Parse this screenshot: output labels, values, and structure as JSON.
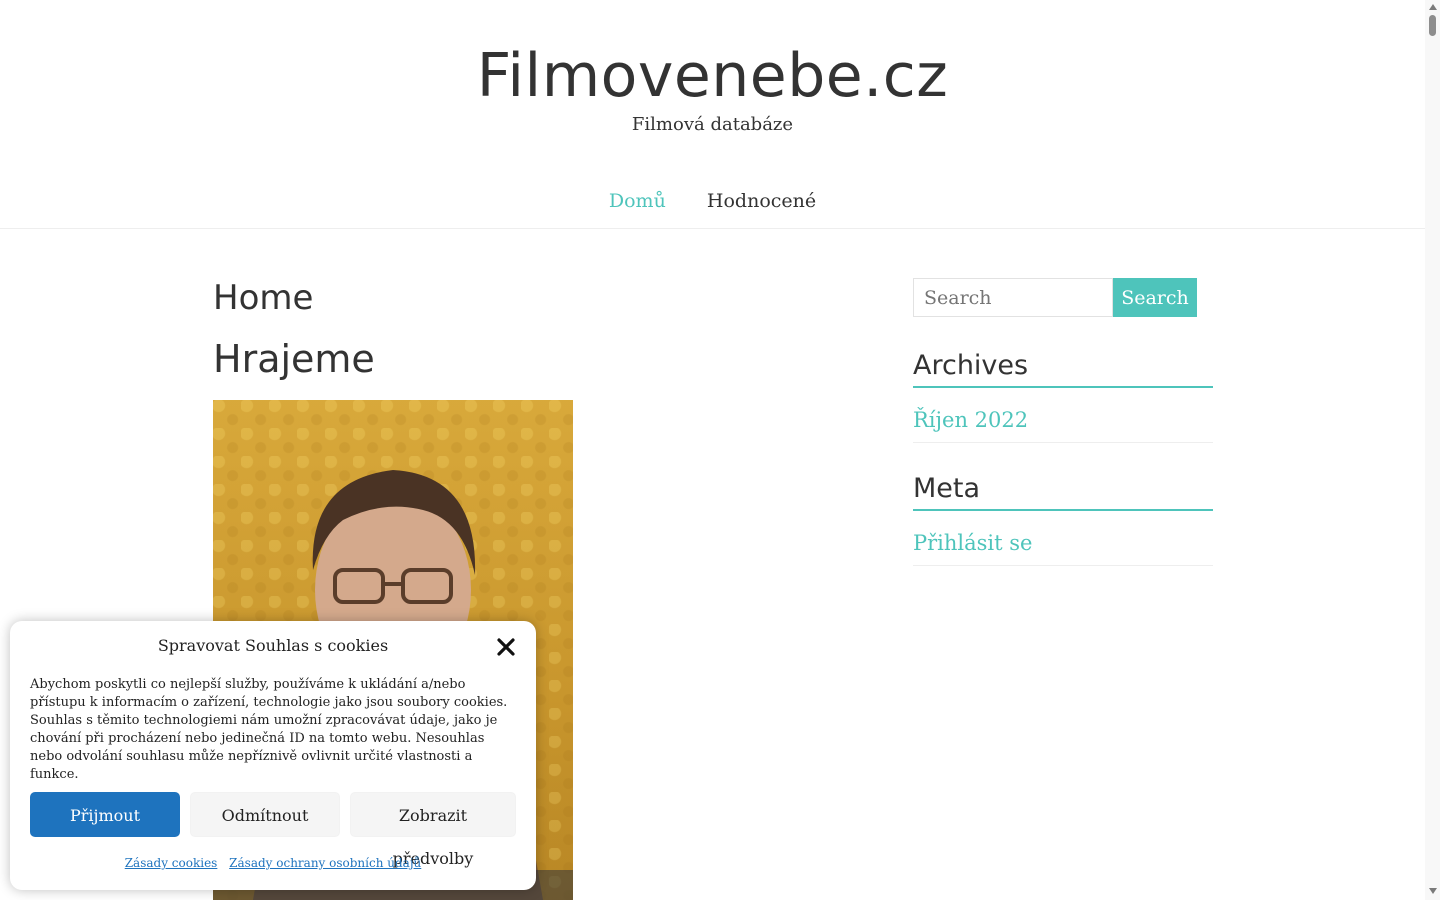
{
  "header": {
    "site_title": "Filmovenebe.cz",
    "tagline": "Filmová databáze",
    "nav": [
      {
        "label": "Domů",
        "active": true
      },
      {
        "label": "Hodnocené",
        "active": false
      }
    ]
  },
  "main": {
    "page_title": "Home",
    "post_title": "Hrajeme"
  },
  "sidebar": {
    "search": {
      "placeholder": "Search",
      "button_label": "Search"
    },
    "archives": {
      "title": "Archives",
      "items": [
        "Říjen 2022"
      ]
    },
    "meta": {
      "title": "Meta",
      "items": [
        "Přihlásit se"
      ]
    }
  },
  "cookie_banner": {
    "title": "Spravovat Souhlas s cookies",
    "text": "Abychom poskytli co nejlepší služby, používáme k ukládání a/nebo přístupu k informacím o zařízení, technologie jako jsou soubory cookies. Souhlas s těmito technologiemi nám umožní zpracovávat údaje, jako je chování při procházení nebo jedinečná ID na tomto webu. Nesouhlas nebo odvolání souhlasu může nepříznivě ovlivnit určité vlastnosti a funkce.",
    "accept_label": "Přijmout",
    "deny_label": "Odmítnout",
    "prefs_label": "Zobrazit předvolby",
    "links": [
      "Zásady cookies",
      "Zásady ochrany osobních údajů"
    ]
  },
  "colors": {
    "accent": "#4ec4bb",
    "primary_button": "#1e73be",
    "text": "#333333"
  }
}
